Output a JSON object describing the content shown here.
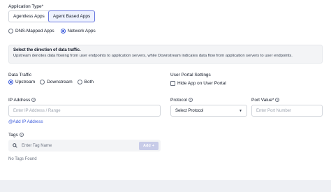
{
  "application_type": {
    "label": "Application Type",
    "required_mark": "*",
    "options": [
      "Agentless Apps",
      "Agent Based Apps"
    ],
    "selected": "Agent Based Apps"
  },
  "app_mode": {
    "options": [
      "DNS-Mapped Apps",
      "Network Apps"
    ],
    "selected": "Network Apps"
  },
  "info": {
    "title": "Select the direction of data traffic.",
    "description": "Upstream denotes data flowing from user endpoints to application servers, while Downstream indicates data flow from application servers to user endpoints."
  },
  "data_traffic": {
    "label": "Data Traffic",
    "options": [
      "Upstream",
      "Downstream",
      "Both"
    ],
    "selected": "Upstream"
  },
  "user_portal": {
    "label": "User Portal Settings",
    "checkbox_label": "Hide App on User Portal"
  },
  "ip_address": {
    "label": "IP Address",
    "placeholder": "Enter IP Address / Range",
    "add_link": "@Add IP Address"
  },
  "protocol": {
    "label": "Protocol",
    "value": "Select Protocol"
  },
  "port": {
    "label": "Port Value",
    "placeholder": "Enter Port Number"
  },
  "tags": {
    "label": "Tags",
    "placeholder": "Enter Tag Name",
    "add_label": "Add",
    "empty_text": "No Tags Found"
  }
}
